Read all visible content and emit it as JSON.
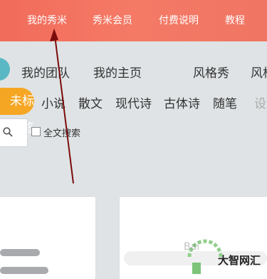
{
  "topnav": {
    "items": [
      "我的秀米",
      "秀米会员",
      "付费说明",
      "教程"
    ]
  },
  "subnav": {
    "items": [
      "我的团队",
      "我的主页",
      "风格秀",
      "风格"
    ]
  },
  "tags": {
    "active": "未标签",
    "items": [
      "小说",
      "散文",
      "现代诗",
      "古体诗",
      "随笔",
      "设"
    ]
  },
  "search": {
    "fulltext_label": "全文搜索",
    "fulltext_checked": false
  },
  "watermark": {
    "text": "大智网汇",
    "faint": "Bai"
  },
  "colors": {
    "topbar": "#f26b5b",
    "tag_active": "#f5a623",
    "arrow": "#7a0c0c"
  }
}
